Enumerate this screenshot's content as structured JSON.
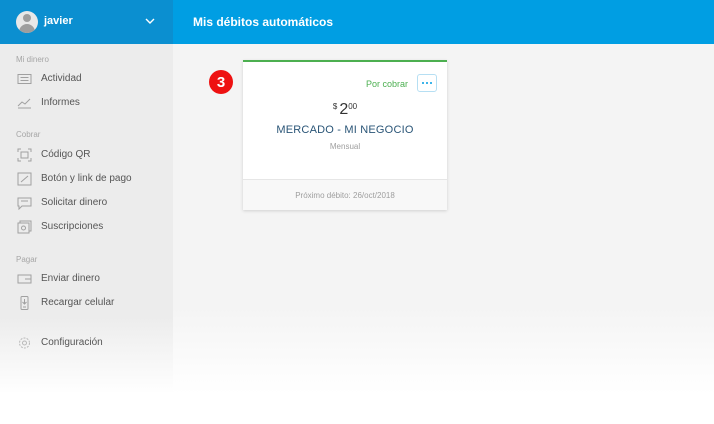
{
  "header": {
    "user_name": "javier",
    "page_title": "Mis débitos automáticos"
  },
  "sidebar": {
    "sections": [
      {
        "label": "Mi dinero",
        "items": [
          {
            "label": "Actividad",
            "icon": "activity-icon"
          },
          {
            "label": "Informes",
            "icon": "reports-icon"
          }
        ]
      },
      {
        "label": "Cobrar",
        "items": [
          {
            "label": "Código QR",
            "icon": "qr-code-icon"
          },
          {
            "label": "Botón y link de pago",
            "icon": "payment-link-icon"
          },
          {
            "label": "Solicitar dinero",
            "icon": "request-money-icon"
          },
          {
            "label": "Suscripciones",
            "icon": "subscriptions-icon"
          }
        ]
      },
      {
        "label": "Pagar",
        "items": [
          {
            "label": "Enviar dinero",
            "icon": "send-money-icon"
          },
          {
            "label": "Recargar celular",
            "icon": "phone-recharge-icon"
          }
        ]
      }
    ],
    "settings": {
      "label": "Configuración",
      "icon": "gear-icon"
    }
  },
  "step_badge": "3",
  "card": {
    "status": "Por cobrar",
    "currency": "$",
    "amount_integer": "2",
    "amount_decimals": "00",
    "merchant": "MERCADO - MI NEGOCIO",
    "frequency": "Mensual",
    "next_debit": "Próximo débito: 26/oct/2018"
  },
  "colors": {
    "header_blue": "#009ee3",
    "status_green": "#4caf50",
    "badge_red": "#ee1111"
  }
}
